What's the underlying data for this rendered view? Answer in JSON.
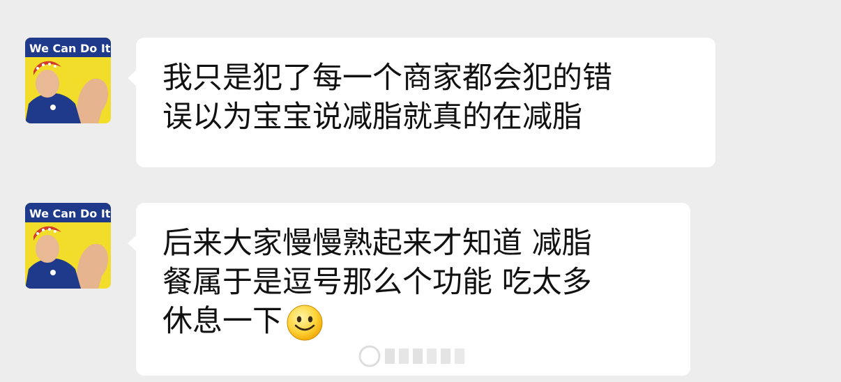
{
  "messages": [
    {
      "sender_avatar": "we-can-do-it-poster",
      "lines": [
        "我只是犯了每一个商家都会犯的错",
        "误以为宝宝说减脂就真的在减脂"
      ]
    },
    {
      "sender_avatar": "we-can-do-it-poster",
      "lines": [
        "后来大家慢慢熟起来才知道 减脂",
        "餐属于是逗号那么个功能 吃太多",
        "休息一下"
      ],
      "emoji": "smiley-emoji"
    }
  ],
  "avatar": {
    "caption": "We Can Do It!"
  },
  "colors": {
    "background": "#ededed",
    "bubble": "#ffffff",
    "text": "#111111",
    "poster_yellow": "#f2dd2a",
    "poster_blue": "#1f3a8a"
  }
}
